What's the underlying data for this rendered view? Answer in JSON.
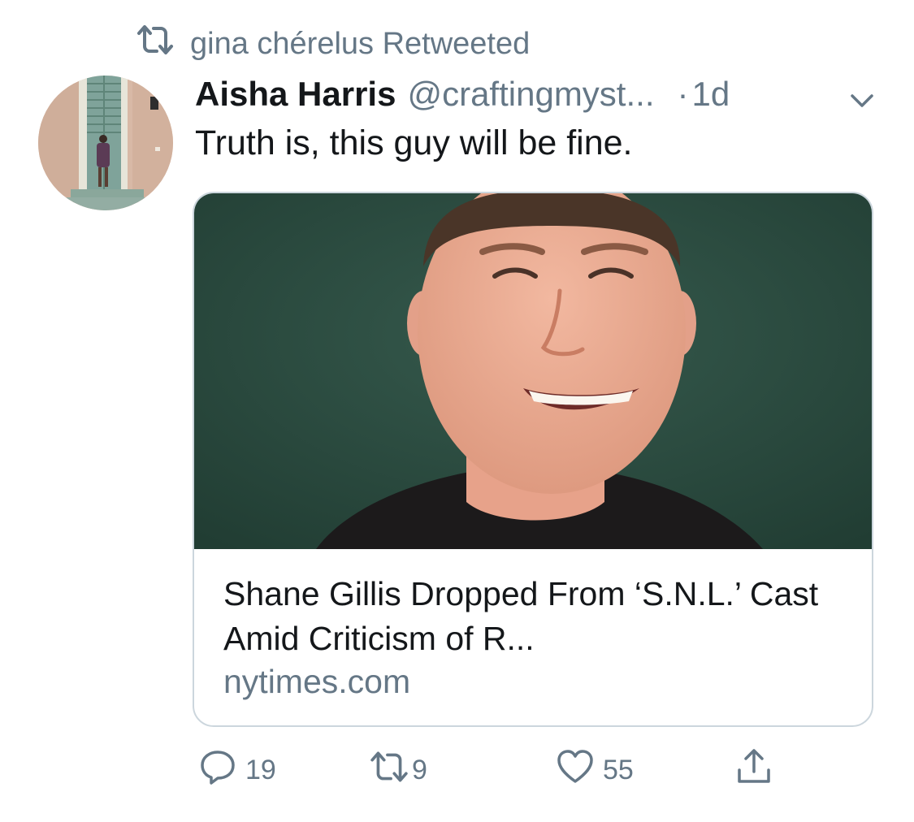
{
  "retweet_banner": {
    "text": "gina chérelus Retweeted"
  },
  "tweet": {
    "display_name": "Aisha Harris",
    "handle": "@craftingmyst...",
    "separator": "·",
    "time": "1d",
    "text": "Truth is, this guy will be fine."
  },
  "card": {
    "title": "Shane Gillis Dropped From ‘S.N.L.’ Cast Amid Criticism of R...",
    "domain": "nytimes.com"
  },
  "actions": {
    "replies": "19",
    "retweets": "9",
    "likes": "55"
  },
  "colors": {
    "muted": "#657786",
    "text": "#14171a",
    "border": "#ccd6dd",
    "card_bg": "#2c4b3f"
  }
}
